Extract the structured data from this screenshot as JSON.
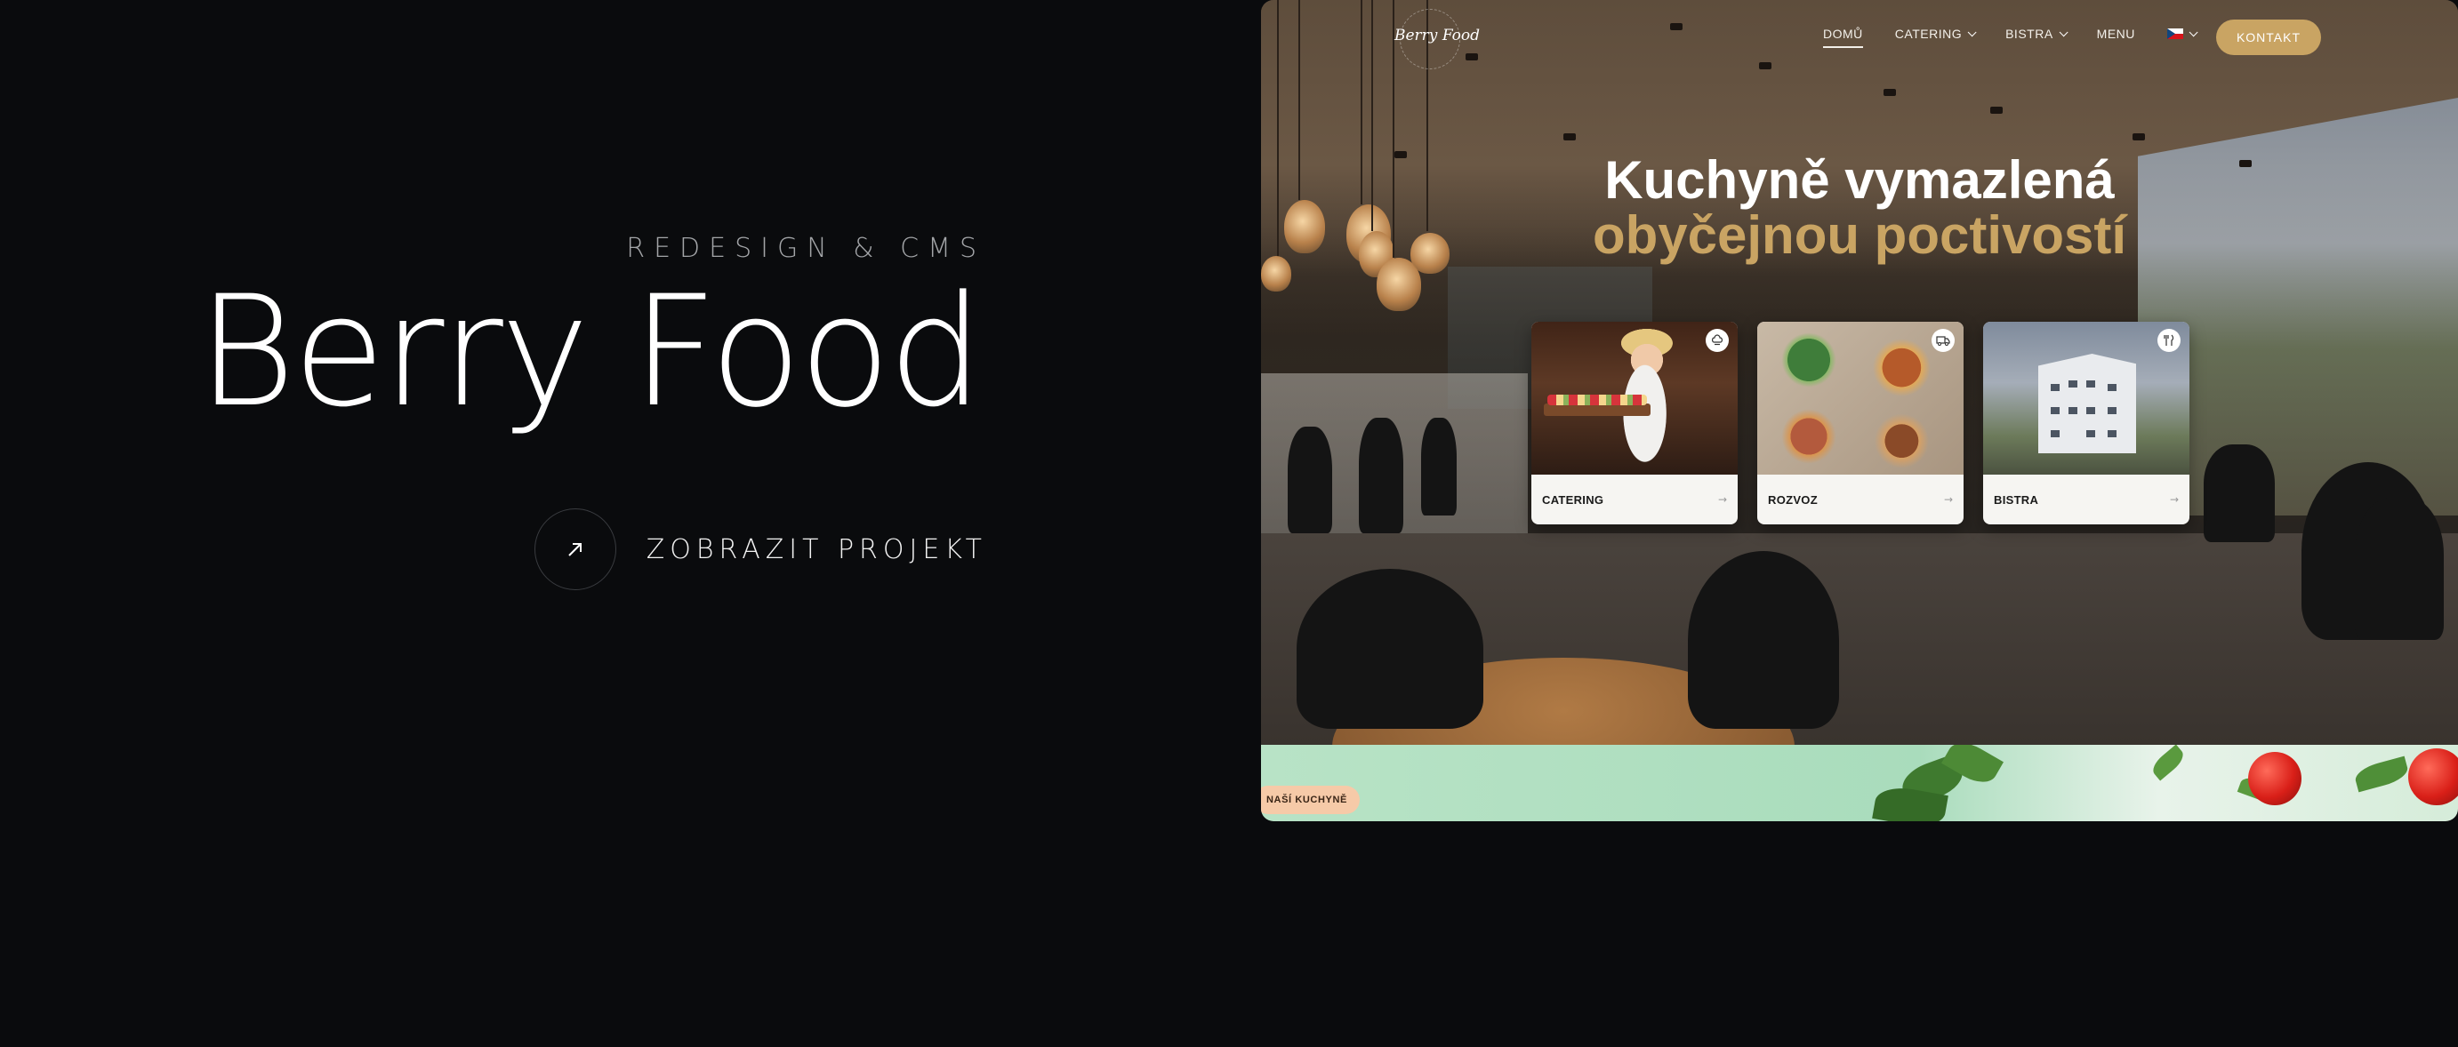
{
  "project": {
    "eyebrow": "REDESIGN & CMS",
    "title": "Berry Food",
    "cta_label": "ZOBRAZIT PROJEKT",
    "cta_icon": "arrow-up-right-icon"
  },
  "site": {
    "logo_text": "Berry Food",
    "nav": {
      "items": [
        {
          "label": "DOMŮ",
          "active": true,
          "dropdown": false
        },
        {
          "label": "CATERING",
          "active": false,
          "dropdown": true
        },
        {
          "label": "BISTRA",
          "active": false,
          "dropdown": true
        },
        {
          "label": "MENU",
          "active": false,
          "dropdown": false
        }
      ],
      "language_icon": "czech-flag-icon",
      "contact_button": "KONTAKT"
    },
    "hero": {
      "line1": "Kuchyně vymazlená",
      "line2": "obyčejnou poctivostí"
    },
    "cards": [
      {
        "label": "CATERING",
        "icon": "chef-hat-icon"
      },
      {
        "label": "ROZVOZ",
        "icon": "delivery-truck-icon"
      },
      {
        "label": "BISTRA",
        "icon": "cutlery-icon"
      }
    ],
    "section_badge": "NAŠÍ KUCHYNĚ"
  },
  "colors": {
    "page_background": "#0a0b0d",
    "accent_gold": "#c9a463",
    "mint_strip": "#b8e3c6",
    "badge_peach": "#f6caa8"
  }
}
